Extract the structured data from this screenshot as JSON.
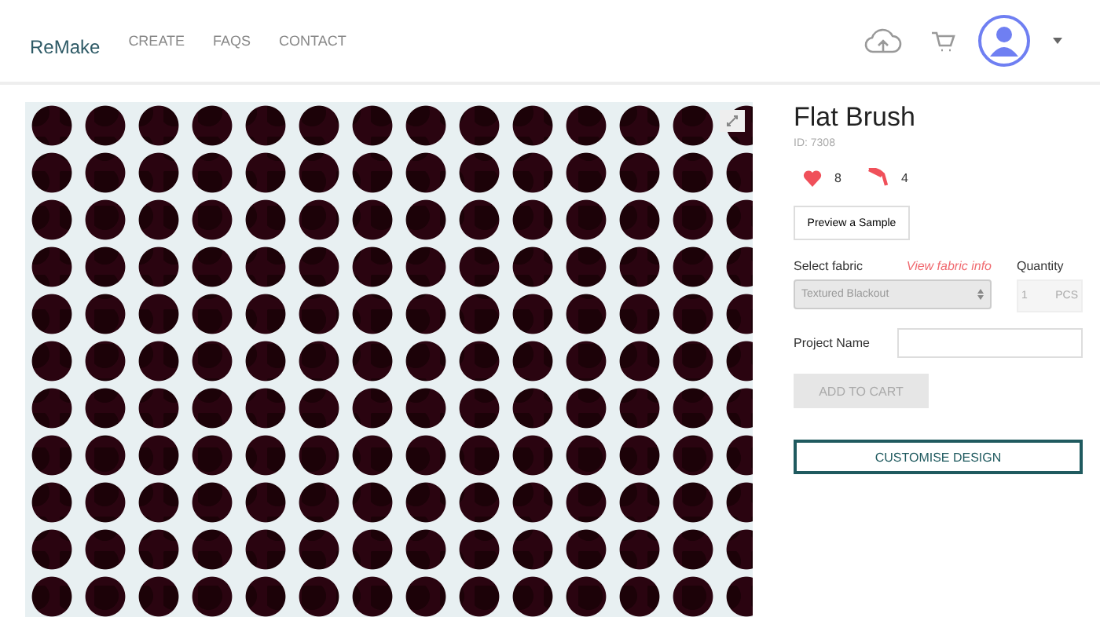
{
  "header": {
    "logo": "ReMake",
    "nav": [
      "CREATE",
      "FAQS",
      "CONTACT"
    ]
  },
  "product": {
    "title": "Flat Brush",
    "id": "ID: 7308",
    "likes": "8",
    "remakes": "4",
    "preview_button": "Preview a Sample",
    "fabric_label": "Select fabric",
    "fabric_link": "View fabric info",
    "fabric_value": "Textured Blackout",
    "quantity_label": "Quantity",
    "quantity_value": "1",
    "quantity_unit": "PCS",
    "project_label": "Project Name",
    "add_to_cart": {
      "label": "ADD TO CART",
      "disabled": true
    },
    "customise_button": "CUSTOMISE DESIGN"
  }
}
